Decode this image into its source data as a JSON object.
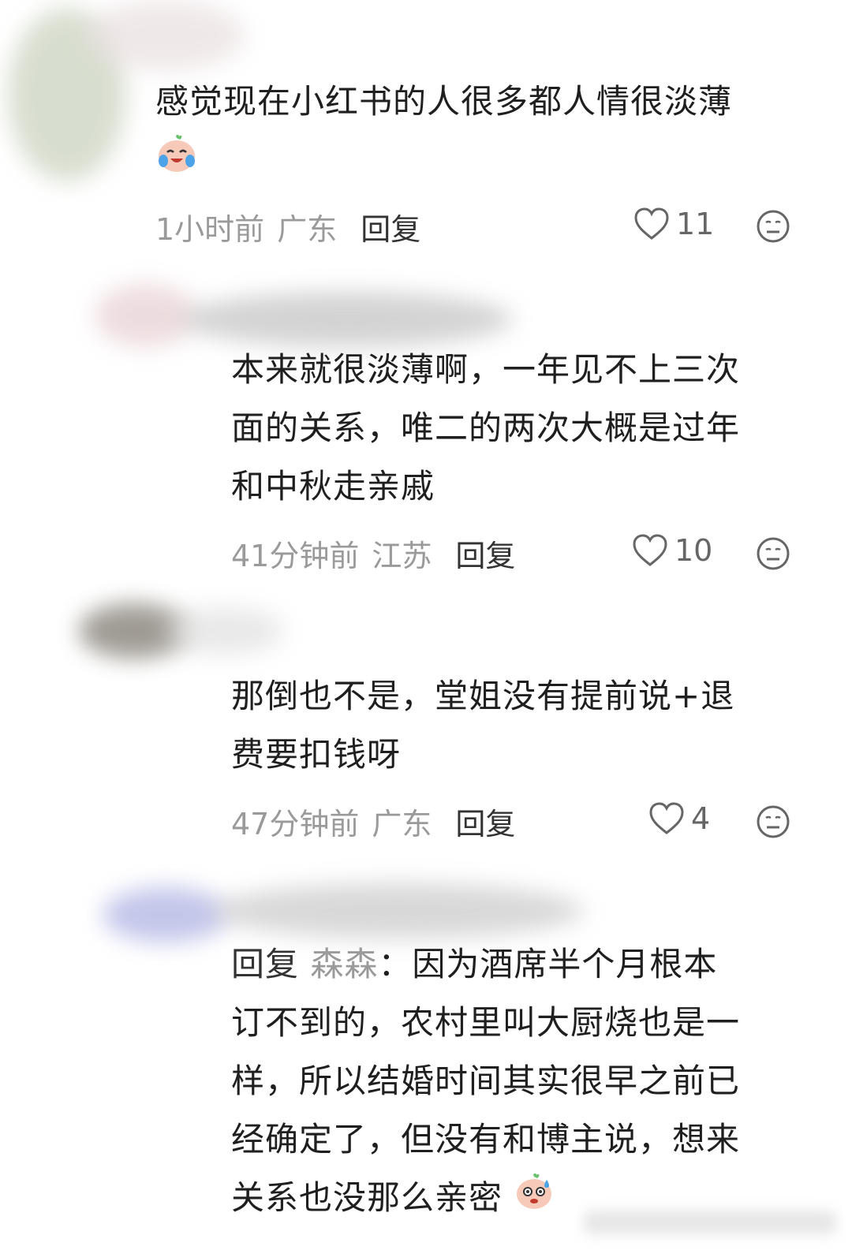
{
  "comments": [
    {
      "text": "感觉现在小红书的人很多都人情很淡薄",
      "emoji": "crying-laughing-emoji",
      "time": "1小时前",
      "location": "广东",
      "reply_label": "回复",
      "likes": "11"
    },
    {
      "text_lines": [
        "本来就很淡薄啊，一年见不上三次",
        "面的关系，唯二的两次大概是过年",
        "和中秋走亲戚"
      ],
      "time": "41分钟前",
      "location": "江苏",
      "reply_label": "回复",
      "likes": "10"
    },
    {
      "text_lines": [
        "那倒也不是，堂姐没有提前说+退",
        "费要扣钱呀"
      ],
      "time": "47分钟前",
      "location": "广东",
      "reply_label": "回复",
      "likes": "4"
    },
    {
      "reply_prefix": "回复",
      "reply_to": "森森",
      "reply_sep": "：",
      "first_line_rest": "因为酒席半个月根本",
      "text_lines": [
        "订不到的，农村里叫大厨烧也是一",
        "样，所以结婚时间其实很早之前已",
        "经确定了，但没有和博主说，想来",
        "关系也没那么亲密"
      ],
      "emoji": "sweat-emoji"
    }
  ],
  "icons": {
    "like": "heart-outline-icon",
    "dislike": "meh-face-icon"
  },
  "colors": {
    "text": "#1f1f1f",
    "meta": "#9a9a9a",
    "icon": "#666666"
  }
}
